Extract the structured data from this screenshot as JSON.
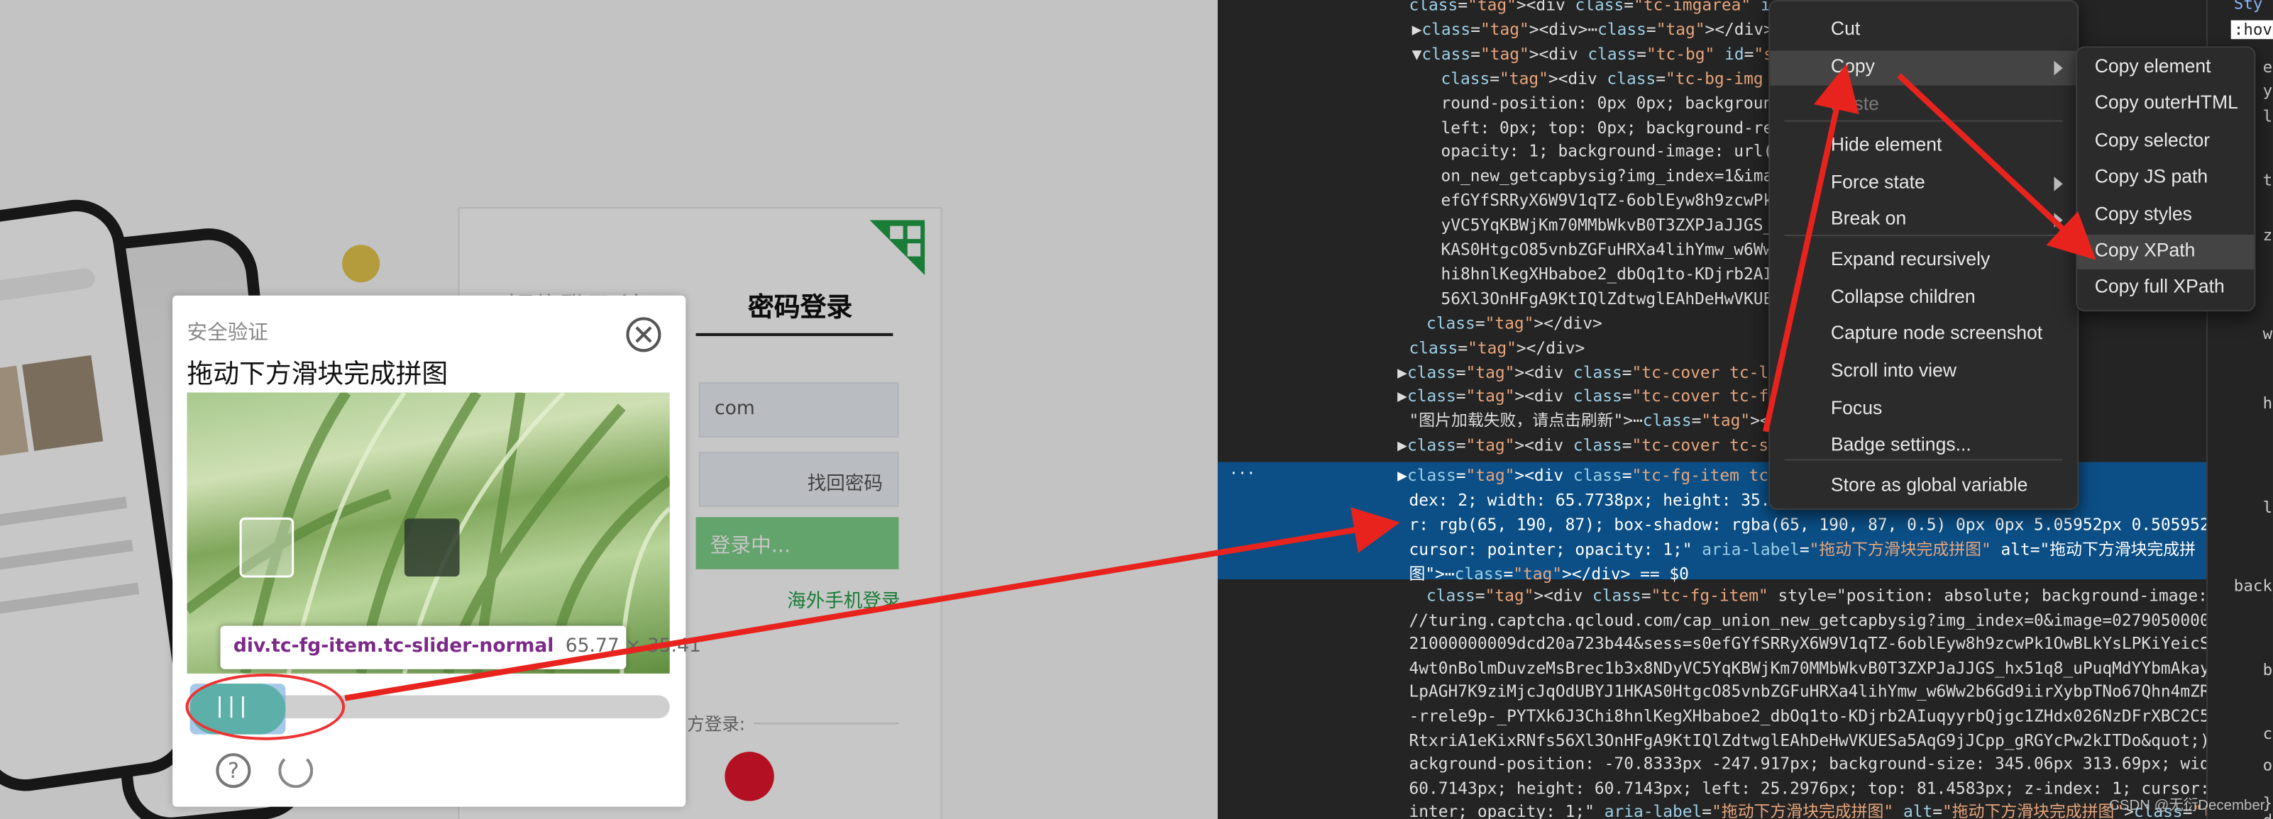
{
  "captcha": {
    "subtitle": "安全验证",
    "title": "拖动下方滑块完成拼图",
    "slider_bars": "|||"
  },
  "tooltip": {
    "selector": "div.tc-fg-item.tc-slider-normal",
    "size": "65.77 × 35.41"
  },
  "login": {
    "tab_other": "短信登录/注册",
    "tab_password": "密码登录",
    "account_value": "com",
    "forgot": "找回密码",
    "login_btn": "登录中...",
    "overseas": "海外手机登录",
    "third_party": "方登录:"
  },
  "devtools": {
    "lines": [
      "<div class=\"tc-imgarea\" id=\"tcImgArea\"",
      "▶<div>⋯</div>",
      "▼<div class=\"tc-bg\" id=\"slideBgWrap\">",
      "<div class=\"tc-bg-img unselectable\"",
      "round-position: 0px 0px; background",
      "left: 0px; top: 0px; background-rep",
      "opacity: 1; background-image: url(&",
      "on_new_getcapbysig?img_index=1&imag",
      "efGYfSRRyX6W9V1qTZ-6oblEyw8h9zcwPk1",
      "yVC5YqKBWjKm70MMbWkvB0T3ZXPJaJJGS_h",
      "KAS0HtgcO85vnbZGFuHRXa4lihYmw_w6Ww2",
      "hi8hnlKegXHbaboe2_dbOq1to-KDjrb2AIu",
      "56Xl3OnHFgA9KtIQlZdtwglEAhDeHwVKUES",
      "</div>",
      "</div>",
      "▶<div class=\"tc-cover tc-loading\">⋯</div>",
      "▶<div class=\"tc-cover tc-fail\" id=\"cover\"",
      "\"图片加载失败，请点击刷新\">⋯</div>",
      "▶<div class=\"tc-cover tc-success\">⋯</div>",
      "▶<div class=\"tc-cover tc-error\">⋯</div>"
    ],
    "hl_lines": [
      "▶<div class=\"tc-fg-item tc-slider-normal\"                    3.393px; z-in",
      "dex: 2; width: 65.7738px; height: 35.41                 background-colo",
      "r: rgb(65, 190, 87); box-shadow: rgba(65, 190, 87, 0.5) 0px 0px 5.05952px 0.505952px;",
      "cursor: pointer; opacity: 1;\" aria-label=\"拖动下方滑块完成拼图\" alt=\"拖动下方滑块完成拼",
      "图\">⋯</div> == $0"
    ],
    "lower_lines": [
      "<div class=\"tc-fg-item\" style=\"position: absolute; background-image: url(&quot;https:",
      "//turing.captcha.qcloud.com/cap_union_new_getcapbysig?img_index=0&image=02790500005c3",
      "21000000009dcd20a723b44&sess=s0efGYfSRRyX6W9V1qTZ-6oblEyw8h9zcwPk1OwBLkYsLPKiYeicSz8v",
      "4wt0nBolmDuvzeMsBrec1b3x8NDyVC5YqKBWjKm70MMbWkvB0T3ZXPJaJJGS_hx51q8_uPuqMdYYbmAkaygJk",
      "LpAGH7K9ziMjcJqOdUBYJ1HKAS0HtgcO85vnbZGFuHRXa4lihYmw_w6Ww2b6Gd9iirXybpTNo67Qhn4mZRffN",
      "-rrele9p-_PYTXk6J3Chi8hnlKegXHbaboe2_dbOq1to-KDjrb2AIuqyyrbQjgc1ZHdx026NzDFrXBC2C53XE",
      "RtxriA1eKixRNfs56Xl3OnHFgA9KtIQlZdtwglEAhDeHwVKUESa5AqG9jJCpp_gRGYcPw2kITDo&quot;); b",
      "ackground-position: -70.8333px -247.917px; background-size: 345.06px 313.69px; width:",
      "60.7143px; height: 60.7143px; left: 25.2976px; top: 81.4583px; z-index: 1; cursor: po",
      "inter; opacity: 1;\" aria-label=\"拖动下方滑块完成拼图\" alt=\"拖动下方滑块完成拼图\"></div>"
    ],
    "aria_label_tail": "aria-label=",
    "ellipsis": "⋯"
  },
  "menu_main": [
    {
      "label": "Cut",
      "disabled": false,
      "submenu": false
    },
    {
      "label": "Copy",
      "disabled": false,
      "submenu": true,
      "active": true
    },
    {
      "label": "Paste",
      "disabled": true,
      "submenu": false
    },
    {
      "label": "Hide element",
      "disabled": false,
      "submenu": false
    },
    {
      "label": "Force state",
      "disabled": false,
      "submenu": true
    },
    {
      "label": "Break on",
      "disabled": false,
      "submenu": true
    },
    {
      "label": "Expand recursively",
      "disabled": false,
      "submenu": false
    },
    {
      "label": "Collapse children",
      "disabled": false,
      "submenu": false
    },
    {
      "label": "Capture node screenshot",
      "disabled": false,
      "submenu": false
    },
    {
      "label": "Scroll into view",
      "disabled": false,
      "submenu": false
    },
    {
      "label": "Focus",
      "disabled": false,
      "submenu": false
    },
    {
      "label": "Badge settings...",
      "disabled": false,
      "submenu": false
    },
    {
      "label": "Store as global variable",
      "disabled": false,
      "submenu": false
    }
  ],
  "menu_copy": [
    {
      "label": "Copy element"
    },
    {
      "label": "Copy outerHTML"
    },
    {
      "label": "Copy selector"
    },
    {
      "label": "Copy JS path"
    },
    {
      "label": "Copy styles"
    },
    {
      "label": "Copy XPath",
      "active": true
    },
    {
      "label": "Copy full XPath"
    }
  ],
  "side_panel": {
    "top_tab": "Sty",
    "hover": ":hov",
    "snippets": [
      "em",
      "yl",
      "l",
      "t",
      "z",
      "w",
      "h",
      "l",
      "back",
      "b",
      "c",
      "o",
      "}",
      "dr",
      "bor"
    ]
  },
  "watermark": "CSDN @无衍December",
  "colors": {
    "accent_green": "#41be57",
    "highlight_blue": "#0b4f86",
    "arrow_red": "#e8231e"
  }
}
